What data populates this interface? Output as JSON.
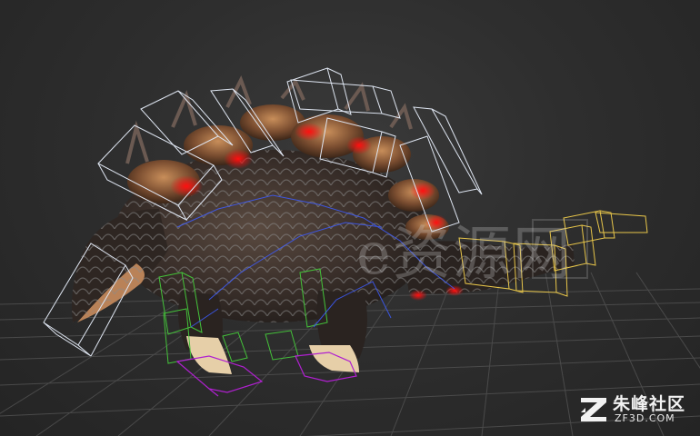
{
  "viewport": {
    "background_color": "#2b2b2b",
    "grid_color": "#4a4a4a",
    "bone_colors": {
      "spine": "#dfe6f2",
      "tail": "#e8c64a",
      "legs": "#44c23a",
      "feet": "#b020d0",
      "links": "#3d5cff"
    },
    "model": "armored-beast-mesh"
  },
  "watermark": {
    "text": "e资源网"
  },
  "brand": {
    "name": "朱峰社区",
    "url": "ZF3D.COM"
  }
}
